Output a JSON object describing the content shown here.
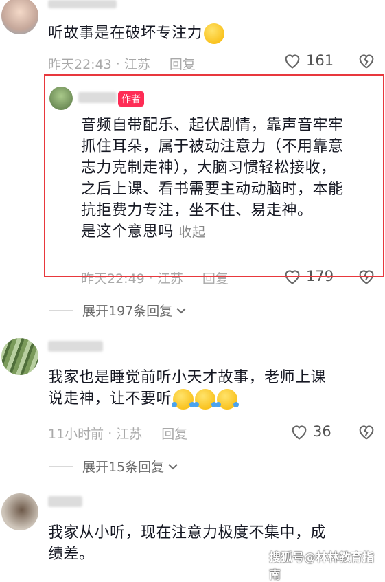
{
  "comments": [
    {
      "text": "听故事是在破坏专注力",
      "time": "昨天22:43",
      "location": "江苏",
      "reply_label": "回复",
      "likes": "161"
    },
    {
      "author_badge": "作者",
      "text_lines": [
        "音频自带配乐、起伏剧情，靠声音牢牢",
        "抓住耳朵，属于被动注意力（不用靠意",
        "志力克制走神），大脑习惯轻松接收，",
        "之后上课、看书需要主动动脑时，本能",
        "抗拒费力专注，坐不住、易走神。",
        "是这个意思吗"
      ],
      "collapse_label": "收起",
      "time": "昨天22:49",
      "location": "江苏",
      "reply_label": "回复",
      "likes": "179",
      "expand_label": "展开197条回复"
    },
    {
      "text_lines": [
        "我家也是睡觉前听小天才故事，老师上课",
        "说走神，让不要听"
      ],
      "time": "11小时前",
      "location": "江苏",
      "reply_label": "回复",
      "likes": "36",
      "expand_label": "展开15条回复"
    },
    {
      "text_lines": [
        "我家从小听，现在注意力极度不集中，成",
        "绩差。"
      ]
    }
  ],
  "watermark": "搜狐号@林林教育指南",
  "colors": {
    "highlight_border": "#e8383d",
    "author_badge": "#fe2c55"
  }
}
